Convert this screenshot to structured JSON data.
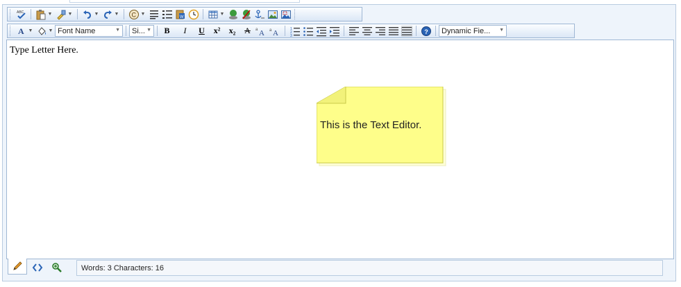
{
  "toolbar1": {
    "items": [
      {
        "name": "spellcheck-icon",
        "glyph": "ABC✓"
      },
      {
        "name": "paste-icon",
        "glyph": "📋"
      },
      {
        "name": "format-stripper-icon",
        "glyph": "🖌"
      },
      {
        "name": "undo-icon",
        "glyph": "↶"
      },
      {
        "name": "redo-icon",
        "glyph": "↷"
      },
      {
        "name": "insert-symbol-icon",
        "glyph": "©"
      },
      {
        "name": "insert-paragraph-icon",
        "glyph": "¶"
      },
      {
        "name": "ordered-list-icon",
        "glyph": "☰"
      },
      {
        "name": "paste-from-word-icon",
        "glyph": "W"
      },
      {
        "name": "insert-date-icon",
        "glyph": "🕒"
      },
      {
        "name": "insert-table-icon",
        "glyph": "▦"
      },
      {
        "name": "hyperlink-icon",
        "glyph": "🔗"
      },
      {
        "name": "remove-link-icon",
        "glyph": "⛓"
      },
      {
        "name": "insert-anchor-icon",
        "glyph": "⚓"
      },
      {
        "name": "image-manager-icon",
        "glyph": "🖼"
      },
      {
        "name": "image-map-icon",
        "glyph": "🗺"
      }
    ]
  },
  "toolbar2": {
    "font_name": "Font Name",
    "font_size": "Si...",
    "bold": "B",
    "italic": "I",
    "underline": "U",
    "superscript": "x²",
    "subscript": "x₂",
    "strikethrough": "A",
    "dynamic_fields": "Dynamic Fie..."
  },
  "editor": {
    "content": "Type Letter Here.",
    "note_text": "This is the Text Editor."
  },
  "status": {
    "text": "Words: 3 Characters: 16"
  },
  "colors": {
    "border": "#9fb7d4",
    "note_fill": "#fefe8a",
    "note_stroke": "#c9c94a"
  }
}
